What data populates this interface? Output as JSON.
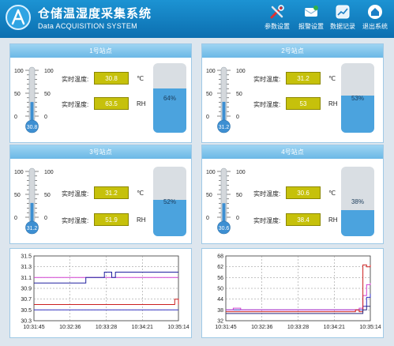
{
  "app": {
    "title": "仓储温湿度采集系统",
    "subtitle": "Data ACQUISITION SYSTEM"
  },
  "nav": [
    {
      "label": "参数设置",
      "icon": "tools-icon"
    },
    {
      "label": "报警设置",
      "icon": "alarm-icon"
    },
    {
      "label": "数据记录",
      "icon": "chart-icon"
    },
    {
      "label": "退出系统",
      "icon": "home-icon"
    }
  ],
  "gauge_scale": [
    "100",
    "50",
    "0"
  ],
  "labels": {
    "temp": "实时温度:",
    "hum": "实时湿度:",
    "temp_unit": "℃",
    "hum_unit": "RH"
  },
  "stations": [
    {
      "name": "1号站点",
      "temp": "30.8",
      "hum": "63.5",
      "tank_pct": "64%",
      "tank_level": 0.64,
      "thermo_level": 0.308
    },
    {
      "name": "2号站点",
      "temp": "31.2",
      "hum": "53",
      "tank_pct": "53%",
      "tank_level": 0.53,
      "thermo_level": 0.312
    },
    {
      "name": "3号站点",
      "temp": "31.2",
      "hum": "51.9",
      "tank_pct": "52%",
      "tank_level": 0.52,
      "thermo_level": 0.312
    },
    {
      "name": "4号站点",
      "temp": "30.6",
      "hum": "38.4",
      "tank_pct": "38%",
      "tank_level": 0.38,
      "thermo_level": 0.306
    }
  ],
  "chart_data": [
    {
      "type": "line",
      "y_ticks": [
        "31.5",
        "31.3",
        "31.1",
        "30.9",
        "30.7",
        "30.5",
        "30.3"
      ],
      "x_ticks": [
        "10:31:45",
        "10:32:36",
        "10:33:28",
        "10:34:21",
        "10:35:14"
      ],
      "ylim": [
        30.3,
        31.5
      ],
      "grid": true,
      "series": [
        {
          "color": "#3030c0",
          "values": [
            30.5,
            30.5,
            30.5,
            30.5,
            30.5,
            30.5,
            30.5,
            30.5,
            30.5,
            30.5,
            30.5,
            30.5,
            30.5,
            30.5,
            30.5,
            30.5,
            30.5,
            30.5,
            30.5,
            30.5,
            30.5,
            30.5,
            30.5,
            30.5,
            30.5,
            30.5,
            30.5,
            30.5,
            30.5,
            30.5,
            30.5,
            30.5,
            30.5,
            30.5,
            30.5,
            30.5,
            30.5,
            30.5,
            30.5,
            30.5
          ]
        },
        {
          "color": "#cc2020",
          "values": [
            30.6,
            30.6,
            30.6,
            30.6,
            30.6,
            30.6,
            30.6,
            30.6,
            30.6,
            30.6,
            30.6,
            30.6,
            30.6,
            30.6,
            30.6,
            30.6,
            30.6,
            30.6,
            30.6,
            30.6,
            30.6,
            30.6,
            30.6,
            30.6,
            30.6,
            30.6,
            30.6,
            30.6,
            30.6,
            30.6,
            30.6,
            30.6,
            30.6,
            30.6,
            30.6,
            30.6,
            30.6,
            30.6,
            30.7,
            30.6
          ]
        },
        {
          "color": "#d040d0",
          "values": [
            31.1,
            31.1,
            31.1,
            31.1,
            31.1,
            31.1,
            31.1,
            31.1,
            31.1,
            31.1,
            31.1,
            31.1,
            31.1,
            31.1,
            31.1,
            31.1,
            31.1,
            31.1,
            31.1,
            31.1,
            31.1,
            31.1,
            31.1,
            31.1,
            31.1,
            31.1,
            31.1,
            31.1,
            31.1,
            31.1,
            31.1,
            31.1,
            31.1,
            31.1,
            31.1,
            31.1,
            31.1,
            31.1,
            31.1,
            31.1
          ]
        },
        {
          "color": "#2020a0",
          "values": [
            31.0,
            31.0,
            31.0,
            31.0,
            31.0,
            31.0,
            31.0,
            31.0,
            31.0,
            31.0,
            31.0,
            31.0,
            31.0,
            31.0,
            31.1,
            31.1,
            31.1,
            31.1,
            31.1,
            31.2,
            31.2,
            31.1,
            31.2,
            31.2,
            31.2,
            31.2,
            31.2,
            31.2,
            31.2,
            31.2,
            31.2,
            31.2,
            31.2,
            31.2,
            31.2,
            31.2,
            31.2,
            31.2,
            31.2,
            31.2
          ]
        }
      ]
    },
    {
      "type": "line",
      "y_ticks": [
        "68",
        "62",
        "56",
        "50",
        "44",
        "38",
        "32"
      ],
      "x_ticks": [
        "10:31:45",
        "10:32:36",
        "10:33:28",
        "10:34:21",
        "10:35:14"
      ],
      "ylim": [
        32,
        68
      ],
      "grid": true,
      "series": [
        {
          "color": "#3030c0",
          "values": [
            38,
            38,
            38,
            38,
            38,
            38,
            38,
            38,
            38,
            38,
            38,
            38,
            38,
            38,
            38,
            38,
            38,
            38,
            38,
            38,
            38,
            38,
            38,
            38,
            38,
            38,
            38,
            38,
            38,
            38,
            38,
            38,
            38,
            38,
            38,
            38,
            38,
            40,
            45,
            47
          ]
        },
        {
          "color": "#d040d0",
          "values": [
            38,
            38,
            39,
            39,
            38,
            38,
            38,
            38,
            38,
            38,
            38,
            38,
            38,
            38,
            38,
            38,
            38,
            38,
            38,
            38,
            38,
            38,
            38,
            38,
            38,
            38,
            38,
            38,
            38,
            38,
            38,
            38,
            38,
            38,
            38,
            38,
            39,
            46,
            52,
            53
          ]
        },
        {
          "color": "#cc2020",
          "values": [
            37,
            37,
            37,
            37,
            37,
            37,
            37,
            37,
            37,
            37,
            37,
            37,
            37,
            37,
            37,
            37,
            37,
            37,
            37,
            37,
            37,
            37,
            37,
            37,
            37,
            37,
            37,
            37,
            37,
            37,
            37,
            37,
            37,
            37,
            37,
            38,
            37,
            63,
            62,
            63
          ]
        },
        {
          "color": "#2a2a80",
          "values": [
            36,
            36,
            36,
            36,
            36,
            36,
            36,
            36,
            36,
            36,
            36,
            36,
            36,
            36,
            36,
            36,
            36,
            36,
            36,
            36,
            36,
            36,
            36,
            36,
            36,
            36,
            36,
            36,
            36,
            36,
            36,
            36,
            36,
            36,
            36,
            36,
            36,
            38,
            40,
            40
          ]
        }
      ]
    }
  ]
}
